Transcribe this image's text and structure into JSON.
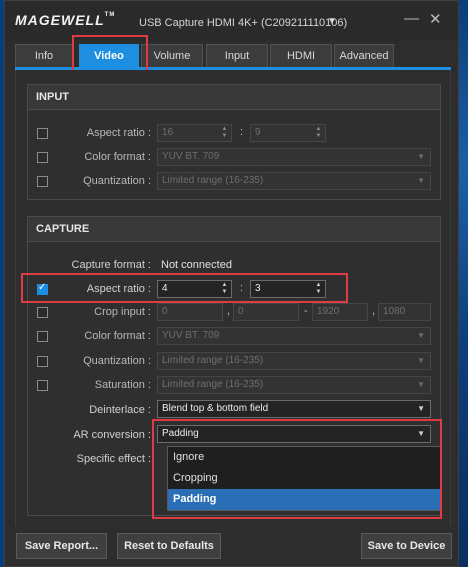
{
  "app": {
    "logo": "MAGEWELL",
    "logo_tm": "TM",
    "device_title": "USB Capture HDMI 4K+ (C209211110106)"
  },
  "window_controls": {
    "minimize": "—",
    "close": "✕"
  },
  "tabs": [
    {
      "label": "Info"
    },
    {
      "label": "Video"
    },
    {
      "label": "Volume"
    },
    {
      "label": "Input"
    },
    {
      "label": "HDMI"
    },
    {
      "label": "Advanced"
    }
  ],
  "input": {
    "title": "INPUT",
    "aspect_ratio": {
      "label": "Aspect ratio :",
      "w": "16",
      "h": "9",
      "sep": ":"
    },
    "color_format": {
      "label": "Color format :",
      "value": "YUV BT. 709"
    },
    "quantization": {
      "label": "Quantization :",
      "value": "Limited range (16-235)"
    }
  },
  "capture": {
    "title": "CAPTURE",
    "capture_format": {
      "label": "Capture format :",
      "value": "Not connected"
    },
    "aspect_ratio": {
      "label": "Aspect ratio :",
      "w": "4",
      "h": "3",
      "sep": ":"
    },
    "crop_input": {
      "label": "Crop input :",
      "v1": "0",
      "v2": "0",
      "v3": "1920",
      "v4": "1080",
      "sep1": ",",
      "sep2": "-",
      "sep3": ","
    },
    "color_format": {
      "label": "Color format :",
      "value": "YUV BT. 709"
    },
    "quantization": {
      "label": "Quantization :",
      "value": "Limited range (16-235)"
    },
    "saturation": {
      "label": "Saturation :",
      "value": "Limited range (16-235)"
    },
    "deinterlace": {
      "label": "Deinterlace :",
      "value": "Blend top & bottom field"
    },
    "ar_conversion": {
      "label": "AR conversion :",
      "value": "Padding",
      "options": [
        "Ignore",
        "Cropping",
        "Padding"
      ]
    },
    "specific_effect": {
      "label": "Specific effect :"
    }
  },
  "buttons": {
    "save_report": "Save Report...",
    "reset": "Reset to Defaults",
    "save_device": "Save to Device"
  },
  "colors": {
    "accent": "#1e8fe0",
    "highlight": "#e03a45",
    "selected_option": "#2a6fb5"
  }
}
